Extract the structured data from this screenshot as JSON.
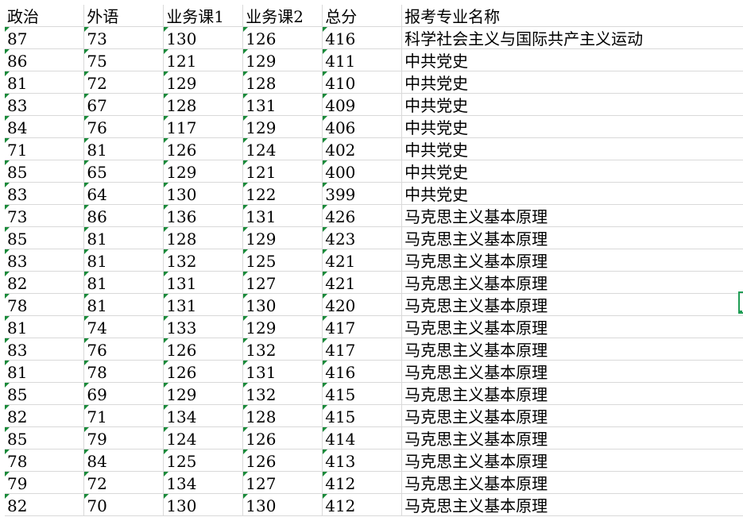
{
  "spreadsheet": {
    "headers": [
      "政治",
      "外语",
      "业务课1",
      "业务课2",
      "总分",
      "报考专业名称"
    ],
    "rows": [
      [
        "87",
        "73",
        "130",
        "126",
        "416",
        "科学社会主义与国际共产主义运动"
      ],
      [
        "86",
        "75",
        "121",
        "129",
        "411",
        "中共党史"
      ],
      [
        "81",
        "72",
        "129",
        "128",
        "410",
        "中共党史"
      ],
      [
        "83",
        "67",
        "128",
        "131",
        "409",
        "中共党史"
      ],
      [
        "84",
        "76",
        "117",
        "129",
        "406",
        "中共党史"
      ],
      [
        "71",
        "81",
        "126",
        "124",
        "402",
        "中共党史"
      ],
      [
        "85",
        "65",
        "129",
        "121",
        "400",
        "中共党史"
      ],
      [
        "83",
        "64",
        "130",
        "122",
        "399",
        "中共党史"
      ],
      [
        "73",
        "86",
        "136",
        "131",
        "426",
        "马克思主义基本原理"
      ],
      [
        "85",
        "81",
        "128",
        "129",
        "423",
        "马克思主义基本原理"
      ],
      [
        "83",
        "81",
        "132",
        "125",
        "421",
        "马克思主义基本原理"
      ],
      [
        "82",
        "81",
        "131",
        "127",
        "421",
        "马克思主义基本原理"
      ],
      [
        "78",
        "81",
        "131",
        "130",
        "420",
        "马克思主义基本原理"
      ],
      [
        "81",
        "74",
        "133",
        "129",
        "417",
        "马克思主义基本原理"
      ],
      [
        "83",
        "76",
        "126",
        "132",
        "417",
        "马克思主义基本原理"
      ],
      [
        "81",
        "78",
        "126",
        "131",
        "416",
        "马克思主义基本原理"
      ],
      [
        "85",
        "69",
        "129",
        "132",
        "415",
        "马克思主义基本原理"
      ],
      [
        "82",
        "71",
        "134",
        "128",
        "415",
        "马克思主义基本原理"
      ],
      [
        "85",
        "79",
        "124",
        "126",
        "414",
        "马克思主义基本原理"
      ],
      [
        "78",
        "84",
        "125",
        "126",
        "413",
        "马克思主义基本原理"
      ],
      [
        "79",
        "72",
        "134",
        "127",
        "412",
        "马克思主义基本原理"
      ],
      [
        "82",
        "70",
        "130",
        "130",
        "412",
        "马克思主义基本原理"
      ]
    ]
  },
  "colors": {
    "gridline": "#d9d9d9",
    "number_stored_as_text_marker": "#1a8a3a",
    "selection": "#1f9d55"
  }
}
